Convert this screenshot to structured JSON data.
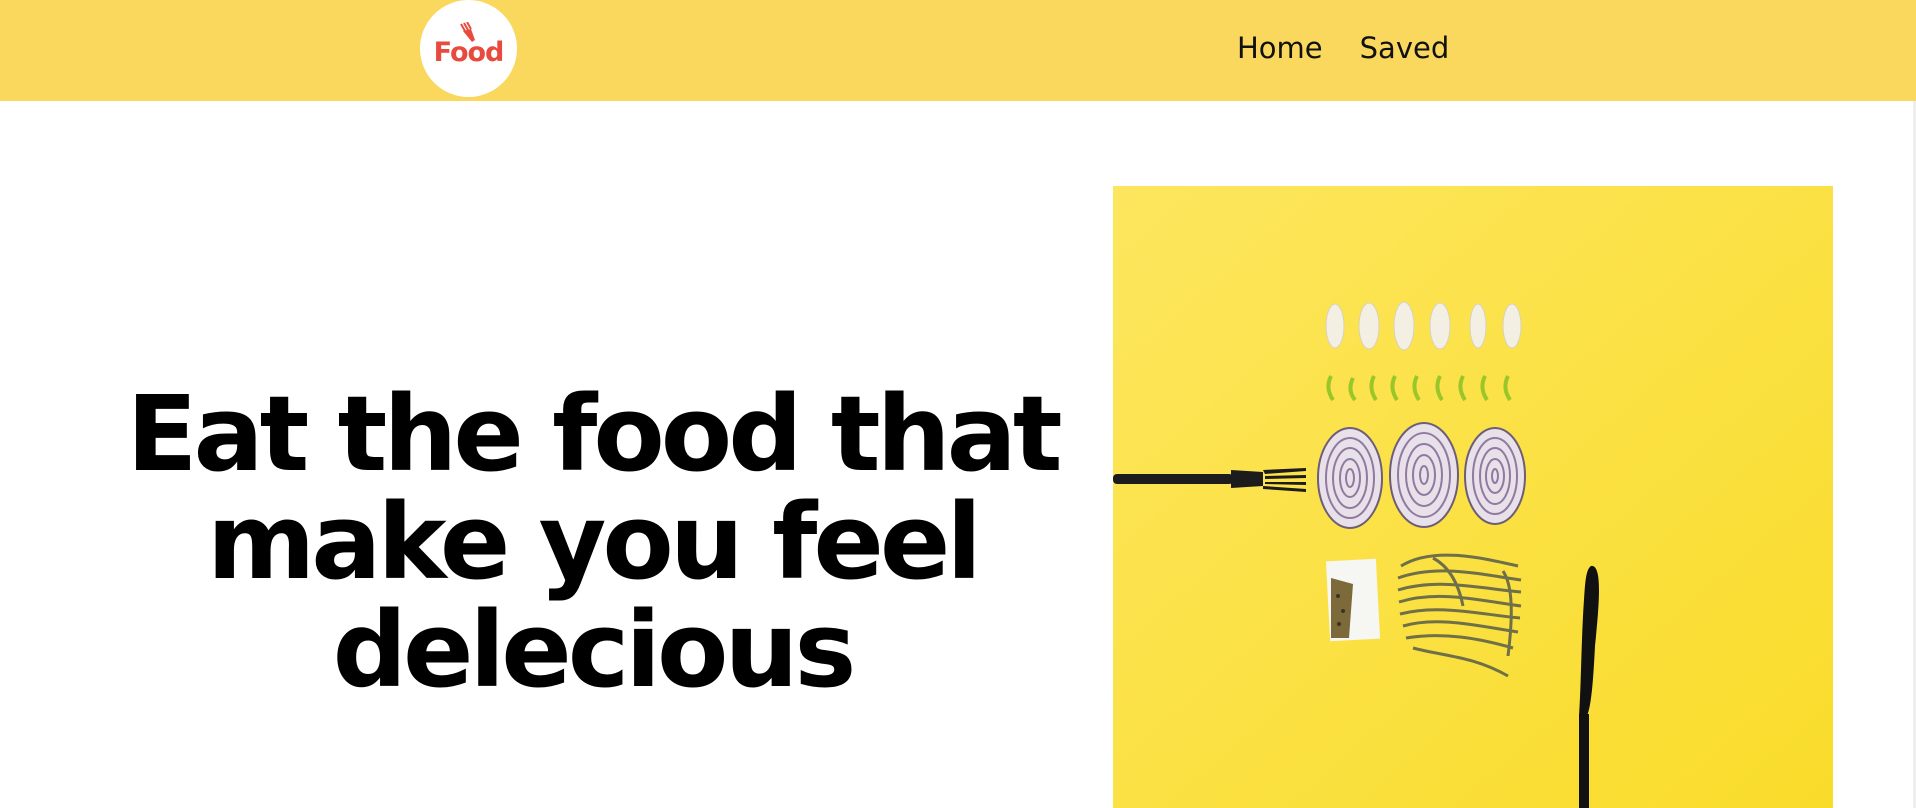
{
  "navbar": {
    "logo_text": "Food",
    "logo_icon": "fork-icon",
    "links": [
      {
        "label": "Home"
      },
      {
        "label": "Saved"
      }
    ]
  },
  "hero": {
    "title": "Eat the food that make you feel delecious",
    "image_subject": "yellow background with fork, knife, garlic cloves, pepper slices, onion rings, herbs and pasta"
  },
  "colors": {
    "navbar_bg": "#f9d85d",
    "logo_red": "#e84a3d",
    "hero_image_bg": "#fde23a"
  }
}
